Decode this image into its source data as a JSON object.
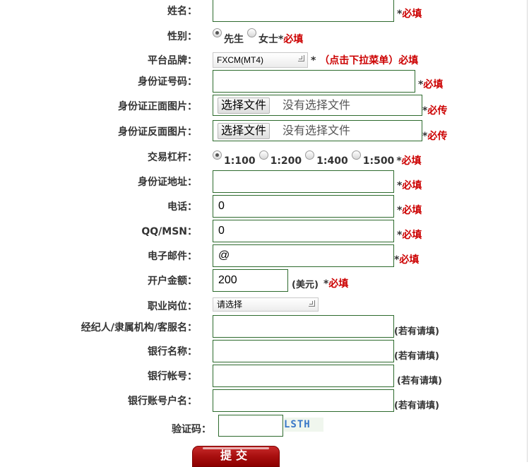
{
  "form": {
    "name_label": "姓名：",
    "name_req": "必填",
    "gender_label": "性别：",
    "gender_options": [
      "先生",
      "女士"
    ],
    "gender_req": "必填",
    "platform_label": "平台品牌：",
    "platform_value": "FXCM(MT4)",
    "platform_note": "（点击下拉菜单）必填",
    "idnum_label": "身份证号码：",
    "idnum_req": "必填",
    "idfront_label": "身份证正面图片：",
    "idback_label": "身份证反面图片：",
    "file_button": "选择文件",
    "file_status": "没有选择文件",
    "upload_req": "必传",
    "leverage_label": "交易杠杆：",
    "leverage_options": [
      "1:100",
      "1:200",
      "1:400",
      "1:500"
    ],
    "leverage_req": "必填",
    "address_label": "身份证地址：",
    "address_req": "必填",
    "phone_label": "电话：",
    "phone_value": "0",
    "phone_req": "必填",
    "qq_label": "QQ/MSN：",
    "qq_value": "0",
    "qq_req": "必填",
    "email_label": "电子邮件：",
    "email_value": "@",
    "email_req": "必填",
    "amount_label": "开户金额：",
    "amount_value": "200",
    "amount_unit": "(美元)",
    "amount_req": "必填",
    "job_label": "职业岗位：",
    "job_value": "请选择",
    "broker_label": "经纪人/隶属机构/客服名：",
    "bank_label": "银行名称：",
    "bankacct_label": "银行帐号：",
    "bankholder_label": "银行账号户名：",
    "optional_note": "(若有请填)",
    "captcha_label": "验证码：",
    "captcha_text": "LSTH",
    "submit_label": "提交"
  },
  "colors": {
    "required": "#cc0000",
    "field_border": "#2e6b2e",
    "submit_bg": "#a80f0f"
  }
}
